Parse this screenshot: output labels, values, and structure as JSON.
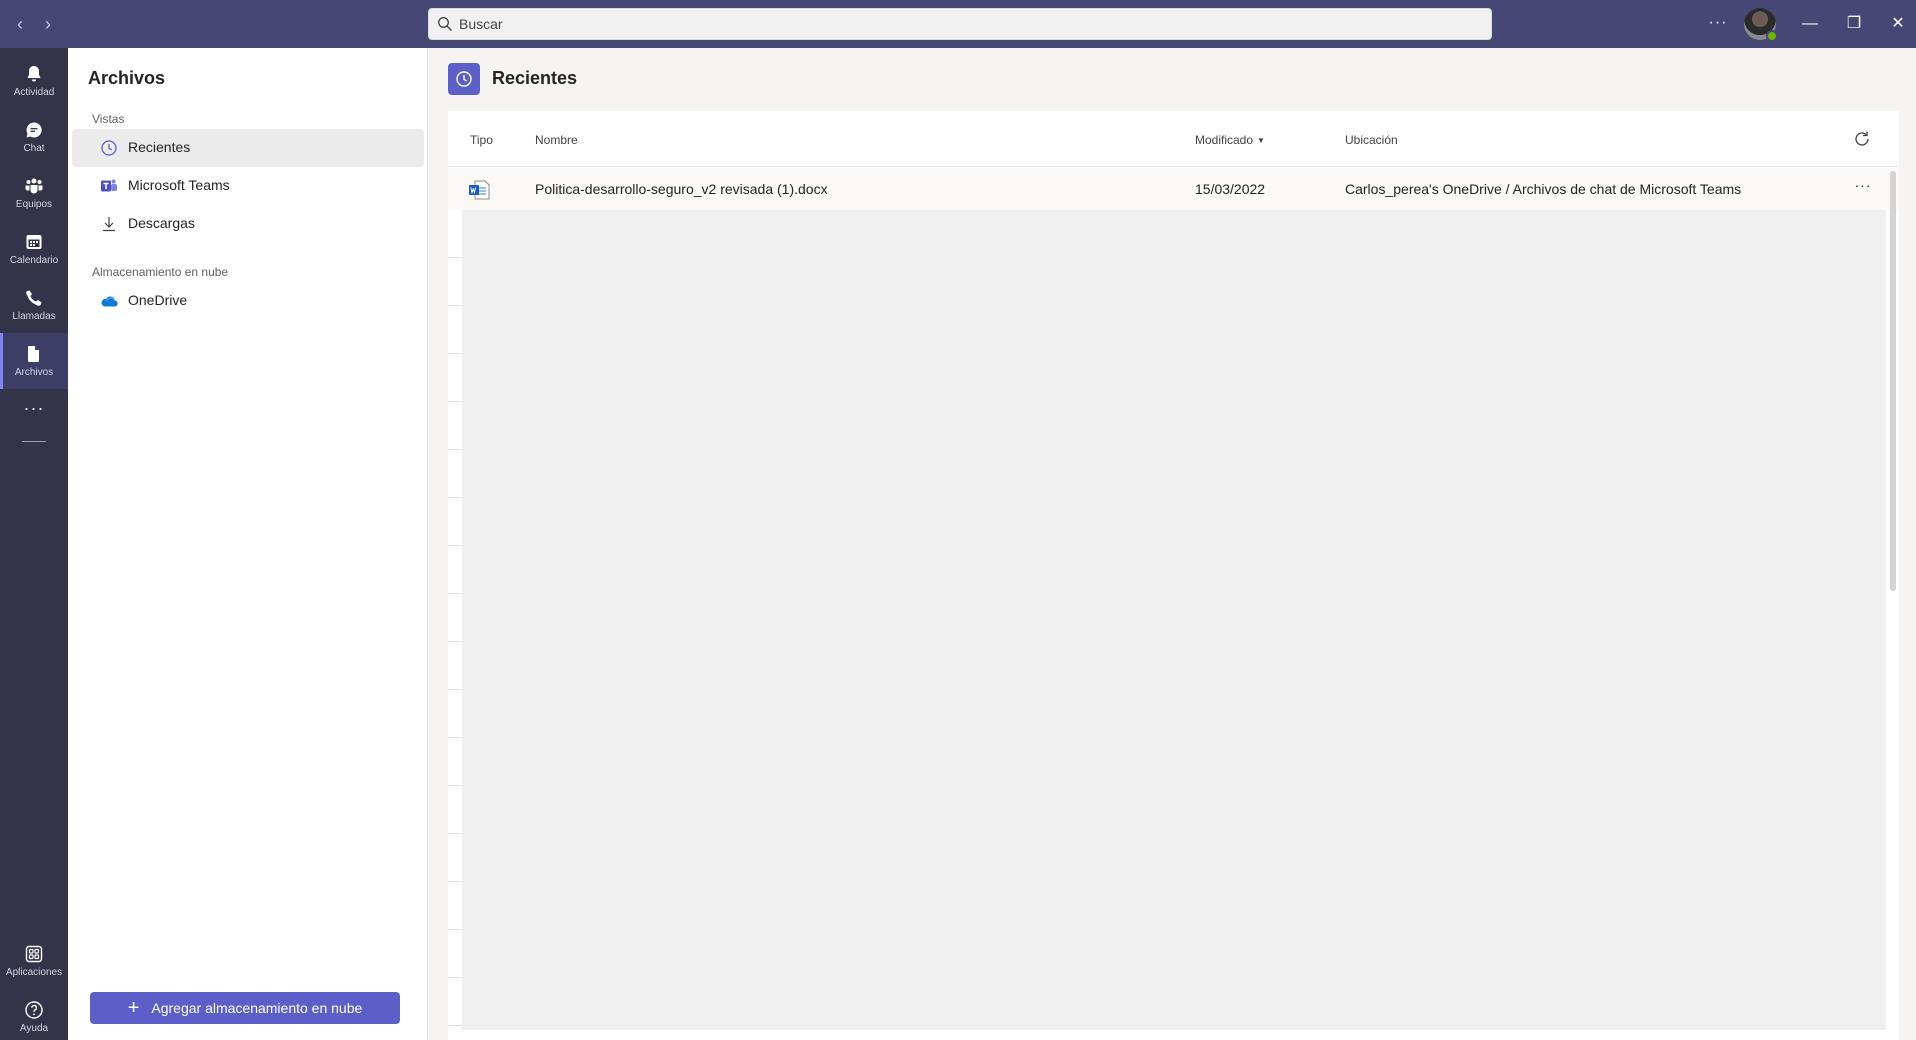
{
  "titlebar": {
    "search_placeholder": "Buscar",
    "more_label": "···"
  },
  "rail": {
    "items": [
      {
        "label": "Actividad",
        "icon": "bell-icon"
      },
      {
        "label": "Chat",
        "icon": "chat-icon"
      },
      {
        "label": "Equipos",
        "icon": "teams-icon"
      },
      {
        "label": "Calendario",
        "icon": "calendar-icon"
      },
      {
        "label": "Llamadas",
        "icon": "phone-icon"
      },
      {
        "label": "Archivos",
        "icon": "file-icon",
        "active": true
      }
    ],
    "more_label": "···",
    "apps_label": "Aplicaciones",
    "help_label": "Ayuda"
  },
  "leftpane": {
    "title": "Archivos",
    "views_section": "Vistas",
    "views": [
      {
        "label": "Recientes",
        "icon": "clock-icon",
        "active": true
      },
      {
        "label": "Microsoft Teams",
        "icon": "microsoft-teams-icon"
      },
      {
        "label": "Descargas",
        "icon": "download-icon"
      }
    ],
    "cloud_section": "Almacenamiento en nube",
    "cloud": [
      {
        "label": "OneDrive",
        "icon": "onedrive-icon"
      }
    ],
    "add_button": "Agregar almacenamiento en nube"
  },
  "main": {
    "title": "Recientes",
    "columns": {
      "tipo": "Tipo",
      "nombre": "Nombre",
      "modificado": "Modificado",
      "ubicacion": "Ubicación"
    },
    "rows": [
      {
        "icon": "word-doc-icon",
        "name": "Politica-desarrollo-seguro_v2 revisada (1).docx",
        "modified": "15/03/2022",
        "location": "Carlos_perea's OneDrive / Archivos de chat de Microsoft Teams",
        "more": "···"
      }
    ]
  },
  "colors": {
    "titlebar": "#464775",
    "rail": "#33344a",
    "accent": "#5b5fc7"
  }
}
